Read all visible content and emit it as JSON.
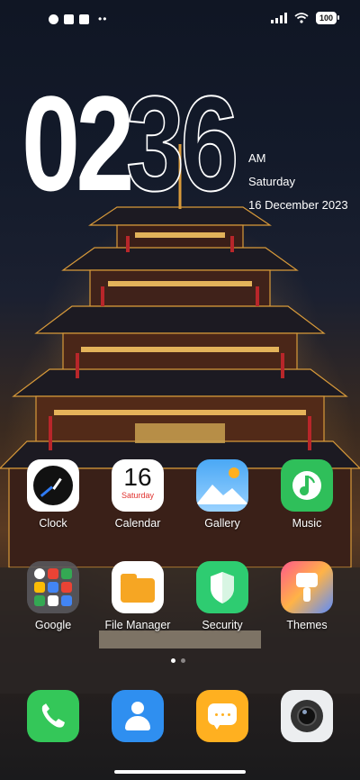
{
  "status_bar": {
    "battery": "100"
  },
  "clock": {
    "hours": "02",
    "minutes": "36",
    "ampm": "AM",
    "weekday": "Saturday",
    "date": "16 December 2023"
  },
  "apps_row1": [
    {
      "label": "Clock",
      "icon": "clock-icon"
    },
    {
      "label": "Calendar",
      "icon": "calendar-icon",
      "day": "16",
      "weekday": "Saturday"
    },
    {
      "label": "Gallery",
      "icon": "gallery-icon"
    },
    {
      "label": "Music",
      "icon": "music-icon"
    }
  ],
  "apps_row2": [
    {
      "label": "Google",
      "icon": "google-folder-icon"
    },
    {
      "label": "File Manager",
      "icon": "folder-icon"
    },
    {
      "label": "Security",
      "icon": "shield-icon"
    },
    {
      "label": "Themes",
      "icon": "brush-icon"
    }
  ],
  "dock": [
    {
      "icon": "phone-icon"
    },
    {
      "icon": "contacts-icon"
    },
    {
      "icon": "messages-icon"
    },
    {
      "icon": "camera-icon"
    }
  ],
  "page_indicator": {
    "current": 1,
    "total": 2
  },
  "colors": {
    "music": "#2fbf5a",
    "security": "#2ecc71",
    "phone": "#34c759",
    "contacts": "#2f8ff0",
    "messages": "#ffb020",
    "filemanager": "#f6a623"
  }
}
